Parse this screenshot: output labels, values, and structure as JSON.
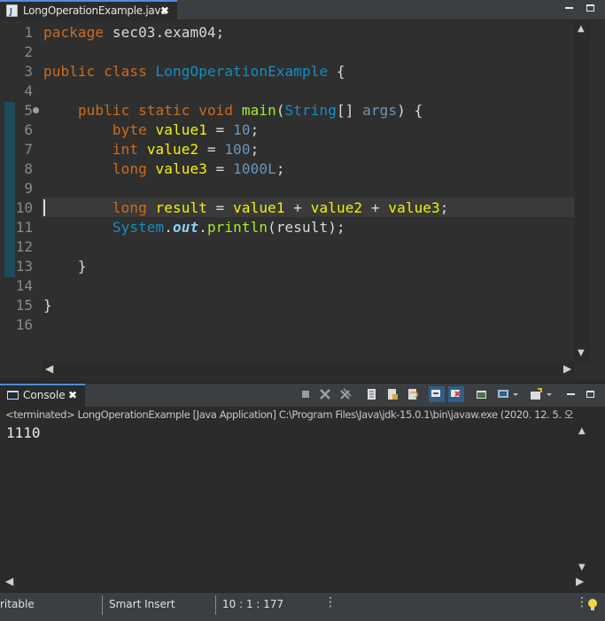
{
  "editor_tab": {
    "title": "LongOperationExample.java",
    "close": "✖"
  },
  "window_controls": {
    "minimize": "minimize",
    "maximize": "maximize"
  },
  "line_numbers": [
    "1",
    "2",
    "3",
    "4",
    "5",
    "6",
    "7",
    "8",
    "9",
    "10",
    "11",
    "12",
    "13",
    "14",
    "15",
    "16"
  ],
  "code_lines": [
    [
      {
        "t": "package",
        "c": "k"
      },
      {
        "t": " sec03.exam04;",
        "c": "pln"
      }
    ],
    [],
    [
      {
        "t": "public",
        "c": "k"
      },
      {
        "t": " ",
        "c": "pln"
      },
      {
        "t": "class",
        "c": "k"
      },
      {
        "t": " ",
        "c": "pln"
      },
      {
        "t": "LongOperationExample",
        "c": "cls"
      },
      {
        "t": " {",
        "c": "pln"
      }
    ],
    [],
    [
      {
        "t": "    ",
        "c": "pln"
      },
      {
        "t": "public",
        "c": "k"
      },
      {
        "t": " ",
        "c": "pln"
      },
      {
        "t": "static",
        "c": "k"
      },
      {
        "t": " ",
        "c": "pln"
      },
      {
        "t": "void",
        "c": "k"
      },
      {
        "t": " ",
        "c": "pln"
      },
      {
        "t": "main",
        "c": "mth"
      },
      {
        "t": "(",
        "c": "pln"
      },
      {
        "t": "String",
        "c": "cls"
      },
      {
        "t": "[] ",
        "c": "pln"
      },
      {
        "t": "args",
        "c": "num"
      },
      {
        "t": ") {",
        "c": "pln"
      }
    ],
    [
      {
        "t": "        ",
        "c": "pln"
      },
      {
        "t": "byte",
        "c": "k"
      },
      {
        "t": " ",
        "c": "pln"
      },
      {
        "t": "value1",
        "c": "var"
      },
      {
        "t": " = ",
        "c": "pln"
      },
      {
        "t": "10",
        "c": "num"
      },
      {
        "t": ";",
        "c": "pln"
      }
    ],
    [
      {
        "t": "        ",
        "c": "pln"
      },
      {
        "t": "int",
        "c": "k"
      },
      {
        "t": " ",
        "c": "pln"
      },
      {
        "t": "value2",
        "c": "var"
      },
      {
        "t": " = ",
        "c": "pln"
      },
      {
        "t": "100",
        "c": "num"
      },
      {
        "t": ";",
        "c": "pln"
      }
    ],
    [
      {
        "t": "        ",
        "c": "pln"
      },
      {
        "t": "long",
        "c": "k"
      },
      {
        "t": " ",
        "c": "pln"
      },
      {
        "t": "value3",
        "c": "var"
      },
      {
        "t": " = ",
        "c": "pln"
      },
      {
        "t": "1000L",
        "c": "num"
      },
      {
        "t": ";",
        "c": "pln"
      }
    ],
    [],
    [
      {
        "t": "        ",
        "c": "pln"
      },
      {
        "t": "long",
        "c": "k"
      },
      {
        "t": " ",
        "c": "pln"
      },
      {
        "t": "result",
        "c": "var"
      },
      {
        "t": " = ",
        "c": "pln"
      },
      {
        "t": "value1",
        "c": "var"
      },
      {
        "t": " + ",
        "c": "pln"
      },
      {
        "t": "value2",
        "c": "var"
      },
      {
        "t": " + ",
        "c": "pln"
      },
      {
        "t": "value3",
        "c": "var"
      },
      {
        "t": ";",
        "c": "pln"
      }
    ],
    [
      {
        "t": "        ",
        "c": "pln"
      },
      {
        "t": "System",
        "c": "cls"
      },
      {
        "t": ".",
        "c": "pln"
      },
      {
        "t": "out",
        "c": "fld"
      },
      {
        "t": ".",
        "c": "pln"
      },
      {
        "t": "println",
        "c": "mth"
      },
      {
        "t": "(result);",
        "c": "pln"
      }
    ],
    [],
    [
      {
        "t": "    }",
        "c": "pln"
      }
    ],
    [],
    [
      {
        "t": "}",
        "c": "pln"
      }
    ],
    []
  ],
  "console": {
    "tab_title": "Console",
    "close": "✖",
    "status": "<terminated> LongOperationExample [Java Application] C:\\Program Files\\Java\\jdk-15.0.1\\bin\\javaw.exe  (2020. 12. 5. 오",
    "output": "1110"
  },
  "statusbar": {
    "writable": "ritable",
    "insert_mode": "Smart Insert",
    "position": "10 : 1 : 177"
  },
  "colors": {
    "keyword": "#cc6c1d",
    "class": "#1290c3",
    "variable": "#f2f200",
    "method": "#a7ec21",
    "number": "#6897bb",
    "field": "#8dd0f9",
    "accent": "#4a90d9"
  }
}
